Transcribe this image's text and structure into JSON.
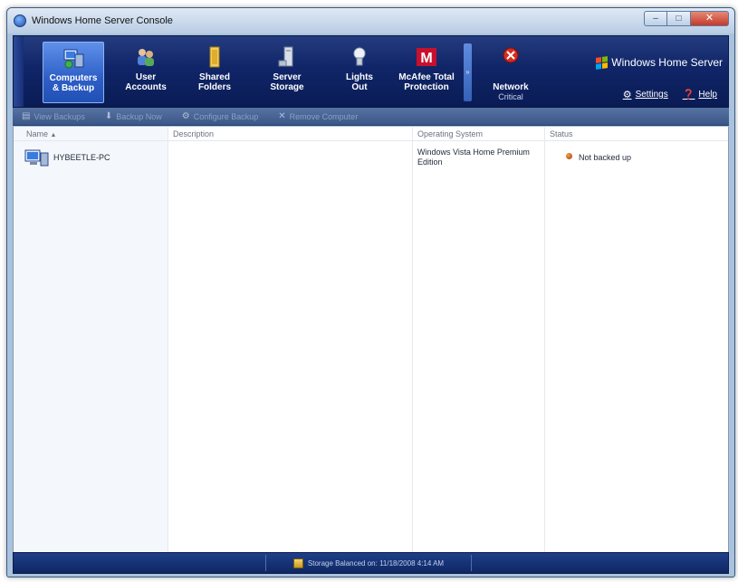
{
  "window": {
    "title": "Windows Home Server Console",
    "controls": {
      "minimize": "–",
      "maximize": "□",
      "close": "✕"
    }
  },
  "nav": {
    "tabs": [
      {
        "line1": "Computers",
        "line2": "& Backup",
        "icon": "computers-backup-icon",
        "selected": true
      },
      {
        "line1": "User",
        "line2": "Accounts",
        "icon": "user-accounts-icon"
      },
      {
        "line1": "Shared",
        "line2": "Folders",
        "icon": "shared-folders-icon"
      },
      {
        "line1": "Server",
        "line2": "Storage",
        "icon": "server-storage-icon"
      },
      {
        "line1": "Lights",
        "line2": "Out",
        "icon": "lights-out-icon"
      },
      {
        "line1": "McAfee Total",
        "line2": "Protection",
        "icon": "mcafee-icon"
      }
    ],
    "scroll_glyph": "»",
    "network": {
      "label": "Network",
      "sub": "Critical",
      "icon": "network-critical-icon"
    },
    "brand": "Windows Home Server",
    "settings_label": "Settings",
    "help_label": "Help"
  },
  "toolbar": {
    "buttons": [
      "View Backups",
      "Backup Now",
      "Configure Backup",
      "Remove Computer"
    ]
  },
  "list": {
    "columns": [
      "Name",
      "Description",
      "Operating System",
      "Status"
    ],
    "sort_glyph": "▲",
    "rows": [
      {
        "name": "HYBEETLE-PC",
        "description": "",
        "os": "Windows Vista Home Premium Edition",
        "status": "Not backed up"
      }
    ]
  },
  "statusbar": {
    "text": "Storage Balanced on: 11/18/2008 4:14 AM"
  },
  "colors": {
    "nav_dark": "#0a1c55",
    "nav_selected": "#2e5fc6",
    "status_warning": "#a4370d",
    "mcafee_red": "#c8102e"
  }
}
